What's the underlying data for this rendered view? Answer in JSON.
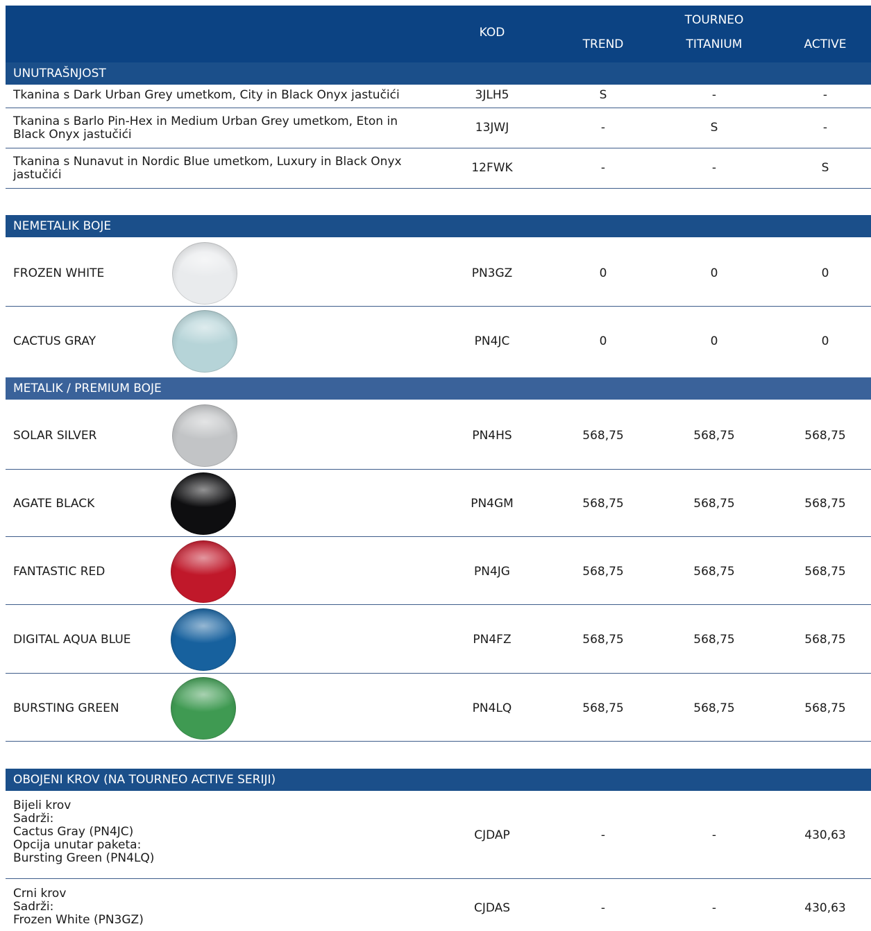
{
  "header": {
    "kod": "KOD",
    "trend": "TREND",
    "tourneo": "TOURNEO",
    "titanium": "TITANIUM",
    "active": "ACTIVE"
  },
  "sections": {
    "interior": "UNUTRAŠNJOST",
    "solid": "NEMETALIK BOJE",
    "metallic": "METALIK / PREMIUM BOJE",
    "roof": "OBOJENI KROV (NA TOURNEO ACTIVE SERIJI)"
  },
  "interior_rows": [
    {
      "lines": [
        "Tkanina s Dark Urban Grey umetkom, City in Black Onyx jastučići"
      ],
      "code": "3JLH5",
      "trend": "S",
      "titanium": "-",
      "active": "-"
    },
    {
      "lines": [
        "Tkanina s Barlo Pin-Hex in Medium Urban Grey umetkom, Eton in",
        "Black Onyx jastučići"
      ],
      "code": "13JWJ",
      "trend": "-",
      "titanium": "S",
      "active": "-"
    },
    {
      "lines": [
        "Tkanina s Nunavut in Nordic Blue umetkom, Luxury in Black Onyx",
        "jastučići"
      ],
      "code": "12FWK",
      "trend": "-",
      "titanium": "-",
      "active": "S"
    }
  ],
  "solid_rows": [
    {
      "name": "FROZEN WHITE",
      "code": "PN3GZ",
      "trend": "0",
      "titanium": "0",
      "active": "0",
      "color": "#e9ebed"
    },
    {
      "name": "CACTUS GRAY",
      "code": "PN4JC",
      "trend": "0",
      "titanium": "0",
      "active": "0",
      "color": "#b6d4d8"
    }
  ],
  "metallic_rows": [
    {
      "name": "SOLAR SILVER",
      "code": "PN4HS",
      "trend": "568,75",
      "titanium": "568,75",
      "active": "568,75",
      "color": "#c2c4c6"
    },
    {
      "name": "AGATE BLACK",
      "code": "PN4GM",
      "trend": "568,75",
      "titanium": "568,75",
      "active": "568,75",
      "color": "#0e0e10"
    },
    {
      "name": "FANTASTIC RED",
      "code": "PN4JG",
      "trend": "568,75",
      "titanium": "568,75",
      "active": "568,75",
      "color": "#c0182a"
    },
    {
      "name": "DIGITAL AQUA BLUE",
      "code": "PN4FZ",
      "trend": "568,75",
      "titanium": "568,75",
      "active": "568,75",
      "color": "#17619e"
    },
    {
      "name": "BURSTING GREEN",
      "code": "PN4LQ",
      "trend": "568,75",
      "titanium": "568,75",
      "active": "568,75",
      "color": "#3f9a52"
    }
  ],
  "roof_rows": [
    {
      "lines": [
        "Bijeli krov",
        "Sadrži:",
        "Cactus Gray (PN4JC)",
        "Opcija unutar paketa:",
        "Bursting Green (PN4LQ)"
      ],
      "code": "CJDAP",
      "trend": "-",
      "titanium": "-",
      "active": "430,63"
    },
    {
      "lines": [
        "Crni krov",
        "Sadrži:",
        "Frozen White (PN3GZ)"
      ],
      "code": "CJDAS",
      "trend": "-",
      "titanium": "-",
      "active": "430,63"
    }
  ]
}
